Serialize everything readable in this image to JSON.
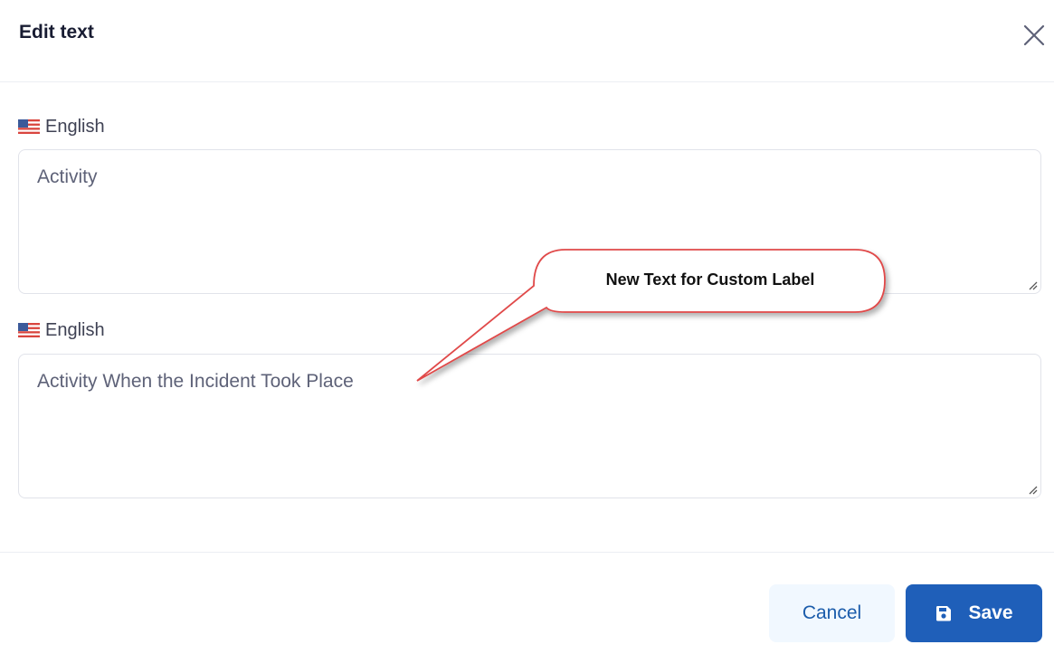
{
  "dialog": {
    "title": "Edit text",
    "close_icon": "close-icon"
  },
  "fields": [
    {
      "language": "English",
      "flag_icon": "us-flag-icon",
      "value": "Activity"
    },
    {
      "language": "English",
      "flag_icon": "us-flag-icon",
      "value": "Activity When the Incident Took Place"
    }
  ],
  "footer": {
    "cancel_label": "Cancel",
    "save_label": "Save",
    "save_icon": "floppy-disk-icon"
  },
  "annotation": {
    "text": "New Text for Custom Label",
    "border_color": "#e04848"
  },
  "colors": {
    "primary": "#1f5fb9",
    "cancel_bg": "#f1f8ff",
    "cancel_text": "#1b5cab"
  }
}
